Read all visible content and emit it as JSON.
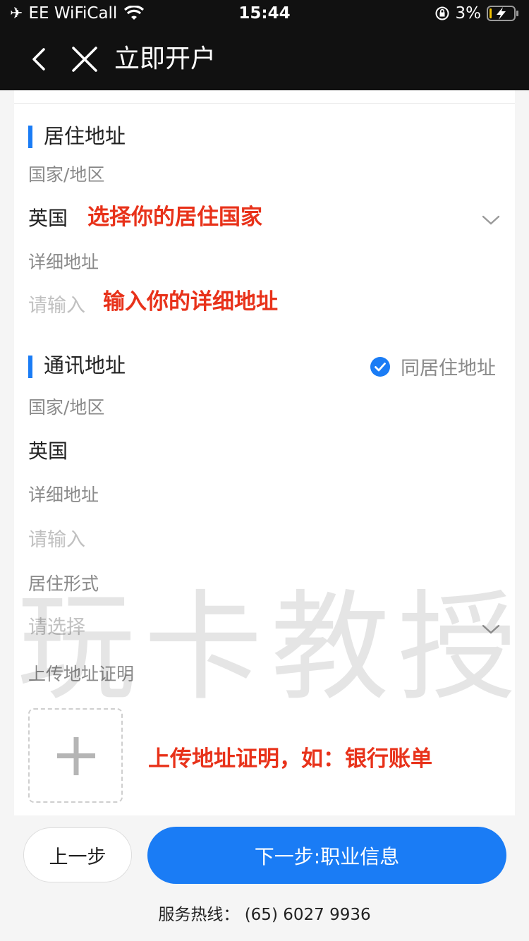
{
  "status_bar": {
    "carrier": "EE WiFiCall",
    "time": "15:44",
    "battery": "3%"
  },
  "nav": {
    "title": "立即开户"
  },
  "residential": {
    "title": "居住地址",
    "country_label": "国家/地区",
    "country_value": "英国",
    "country_annotation": "选择你的居住国家",
    "detail_label": "详细地址",
    "detail_placeholder": "请输入",
    "detail_annotation": "输入你的详细地址"
  },
  "mailing": {
    "title": "通讯地址",
    "same_as_label": "同居住地址",
    "same_as_checked": true,
    "country_label": "国家/地区",
    "country_value": "英国",
    "detail_label": "详细地址",
    "detail_placeholder": "请输入",
    "residence_type_label": "居住形式",
    "residence_type_placeholder": "请选择",
    "upload_label": "上传地址证明",
    "upload_annotation": "上传地址证明，如：银行账单"
  },
  "watermark": "玩卡教授",
  "buttons": {
    "prev": "上一步",
    "next": "下一步:职业信息"
  },
  "hotline": "服务热线： (65) 6027 9936",
  "colors": {
    "accent": "#1a7cf5",
    "annotation": "#e8321a",
    "header_bg": "#111111"
  }
}
